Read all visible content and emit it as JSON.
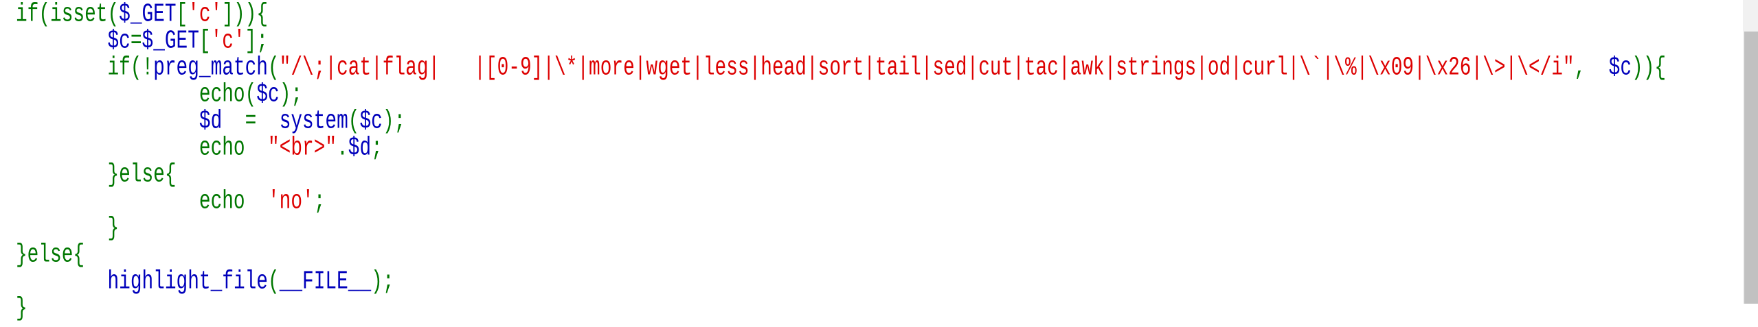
{
  "colors": {
    "keyword": "#007700",
    "default": "#0000BB",
    "string": "#DD0000"
  },
  "code_lines": [
    [
      [
        "if(isset(",
        "g"
      ],
      [
        "$_GET",
        "b"
      ],
      [
        "[",
        "g"
      ],
      [
        "'c'",
        "r"
      ],
      [
        "])){",
        "g"
      ]
    ],
    [
      [
        "        ",
        "g"
      ],
      [
        "$c",
        "b"
      ],
      [
        "=",
        "g"
      ],
      [
        "$_GET",
        "b"
      ],
      [
        "[",
        "g"
      ],
      [
        "'c'",
        "r"
      ],
      [
        "];",
        "g"
      ]
    ],
    [
      [
        "        if(!",
        "g"
      ],
      [
        "preg_match",
        "b"
      ],
      [
        "(",
        "g"
      ],
      [
        "\"/\\;|cat|flag|   |[0-9]|\\*|more|wget|less|head|sort|tail|sed|cut|tac|awk|strings|od|curl|\\`|\\%|\\x09|\\x26|\\>|\\</i\"",
        "r"
      ],
      [
        ",  ",
        "g"
      ],
      [
        "$c",
        "b"
      ],
      [
        ")){",
        "g"
      ]
    ],
    [
      [
        "                echo(",
        "g"
      ],
      [
        "$c",
        "b"
      ],
      [
        ");",
        "g"
      ]
    ],
    [
      [
        "                ",
        "g"
      ],
      [
        "$d",
        "b"
      ],
      [
        "  =  ",
        "g"
      ],
      [
        "system",
        "b"
      ],
      [
        "(",
        "g"
      ],
      [
        "$c",
        "b"
      ],
      [
        ");",
        "g"
      ]
    ],
    [
      [
        "                echo  ",
        "g"
      ],
      [
        "\"<br>\"",
        "r"
      ],
      [
        ".",
        "g"
      ],
      [
        "$d",
        "b"
      ],
      [
        ";",
        "g"
      ]
    ],
    [
      [
        "        }else{",
        "g"
      ]
    ],
    [
      [
        "                echo  ",
        "g"
      ],
      [
        "'no'",
        "r"
      ],
      [
        ";",
        "g"
      ]
    ],
    [
      [
        "        }",
        "g"
      ]
    ],
    [
      [
        "}else{",
        "g"
      ]
    ],
    [
      [
        "        ",
        "g"
      ],
      [
        "highlight_file",
        "b"
      ],
      [
        "(",
        "g"
      ],
      [
        "__FILE__",
        "b"
      ],
      [
        ");",
        "g"
      ]
    ],
    [
      [
        "}",
        "g"
      ]
    ]
  ]
}
